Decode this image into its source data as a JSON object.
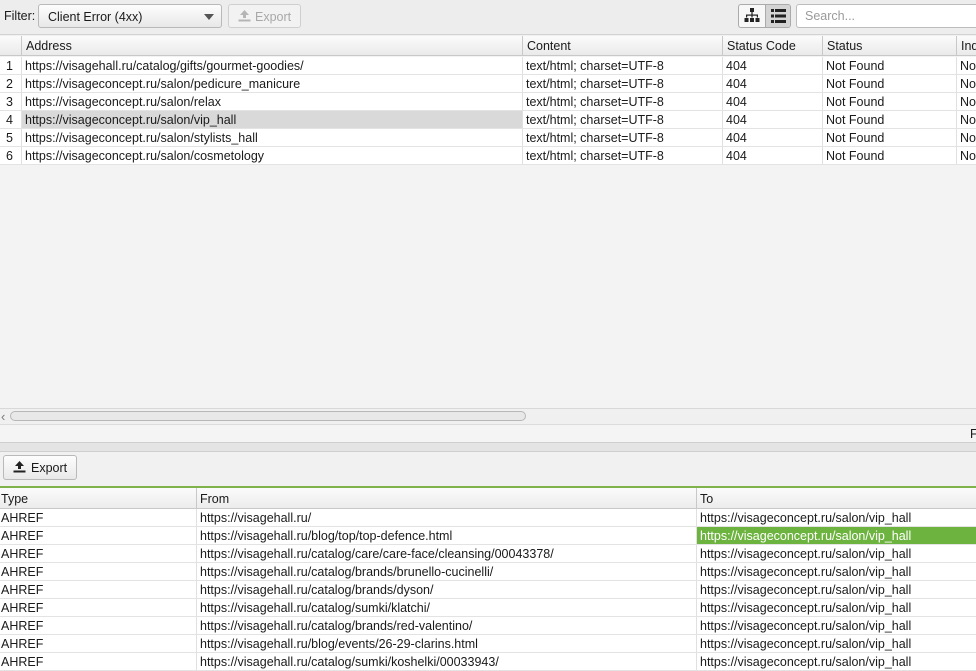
{
  "toolbar": {
    "filter_label": "Filter:",
    "filter_value": "Client Error (4xx)",
    "export_label": "Export",
    "search_placeholder": "Search..."
  },
  "upper_table": {
    "columns": [
      "Address",
      "Content",
      "Status Code",
      "Status",
      "Ind"
    ],
    "rows": [
      {
        "num": "1",
        "address": "https://visagehall.ru/catalog/gifts/gourmet-goodies/",
        "content": "text/html; charset=UTF-8",
        "code": "404",
        "status": "Not Found",
        "idx": "No"
      },
      {
        "num": "2",
        "address": "https://visageconcept.ru/salon/pedicure_manicure",
        "content": "text/html; charset=UTF-8",
        "code": "404",
        "status": "Not Found",
        "idx": "No"
      },
      {
        "num": "3",
        "address": "https://visageconcept.ru/salon/relax",
        "content": "text/html; charset=UTF-8",
        "code": "404",
        "status": "Not Found",
        "idx": "No"
      },
      {
        "num": "4",
        "address": "https://visageconcept.ru/salon/vip_hall",
        "content": "text/html; charset=UTF-8",
        "code": "404",
        "status": "Not Found",
        "idx": "No"
      },
      {
        "num": "5",
        "address": "https://visageconcept.ru/salon/stylists_hall",
        "content": "text/html; charset=UTF-8",
        "code": "404",
        "status": "Not Found",
        "idx": "No"
      },
      {
        "num": "6",
        "address": "https://visageconcept.ru/salon/cosmetology",
        "content": "text/html; charset=UTF-8",
        "code": "404",
        "status": "Not Found",
        "idx": "No"
      }
    ],
    "selected_row": 4
  },
  "status_bar": {
    "text": "F"
  },
  "lower": {
    "export_label": "Export",
    "columns": [
      "Type",
      "From",
      "To"
    ],
    "rows": [
      {
        "type": "AHREF",
        "from": "https://visagehall.ru/",
        "to": "https://visageconcept.ru/salon/vip_hall"
      },
      {
        "type": "AHREF",
        "from": "https://visagehall.ru/blog/top/top-defence.html",
        "to": "https://visageconcept.ru/salon/vip_hall"
      },
      {
        "type": "AHREF",
        "from": "https://visagehall.ru/catalog/care/care-face/cleansing/00043378/",
        "to": "https://visageconcept.ru/salon/vip_hall"
      },
      {
        "type": "AHREF",
        "from": "https://visagehall.ru/catalog/brands/brunello-cucinelli/",
        "to": "https://visageconcept.ru/salon/vip_hall"
      },
      {
        "type": "AHREF",
        "from": "https://visagehall.ru/catalog/brands/dyson/",
        "to": "https://visageconcept.ru/salon/vip_hall"
      },
      {
        "type": "AHREF",
        "from": "https://visagehall.ru/catalog/sumki/klatchi/",
        "to": "https://visageconcept.ru/salon/vip_hall"
      },
      {
        "type": "AHREF",
        "from": "https://visagehall.ru/catalog/brands/red-valentino/",
        "to": "https://visageconcept.ru/salon/vip_hall"
      },
      {
        "type": "AHREF",
        "from": "https://visagehall.ru/blog/events/26-29-clarins.html",
        "to": "https://visageconcept.ru/salon/vip_hall"
      },
      {
        "type": "AHREF",
        "from": "https://visagehall.ru/catalog/sumki/koshelki/00033943/",
        "to": "https://visageconcept.ru/salon/vip_hall"
      }
    ],
    "highlighted_row": 2,
    "highlight_color": "#6db33f"
  },
  "icons": {
    "export": "upload-icon",
    "tree_view": "site-tree-icon",
    "list_view": "list-view-icon",
    "dropdown": "chevron-down-icon"
  }
}
